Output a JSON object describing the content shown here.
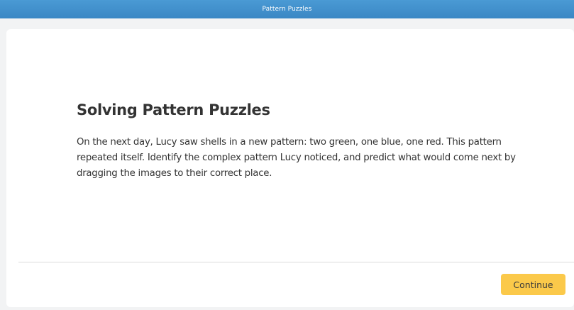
{
  "header": {
    "title": "Pattern Puzzles",
    "color": "#3f8fcb"
  },
  "content": {
    "heading": "Solving Pattern Puzzles",
    "body": "On the next day, Lucy saw shells in a new pattern: two green, one blue, one red. This pattern repeated itself. Identify the complex pattern Lucy noticed, and predict what would come next by dragging the images to their correct place."
  },
  "footer": {
    "continue_label": "Continue",
    "continue_color": "#fbc94a"
  }
}
